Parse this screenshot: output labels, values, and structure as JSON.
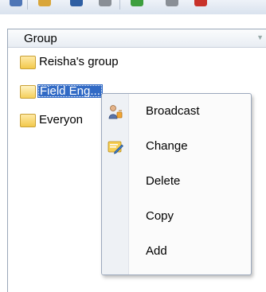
{
  "tree": {
    "header": "Group",
    "items": [
      {
        "label": "Reisha's group"
      },
      {
        "label": "Field Eng..."
      },
      {
        "label": "Everyon"
      }
    ]
  },
  "context_menu": {
    "items": [
      {
        "label": "Broadcast",
        "icon": "broadcast-icon"
      },
      {
        "label": "Change",
        "icon": "edit-icon"
      },
      {
        "label": "Delete"
      },
      {
        "label": "Copy"
      },
      {
        "label": "Add"
      }
    ]
  }
}
